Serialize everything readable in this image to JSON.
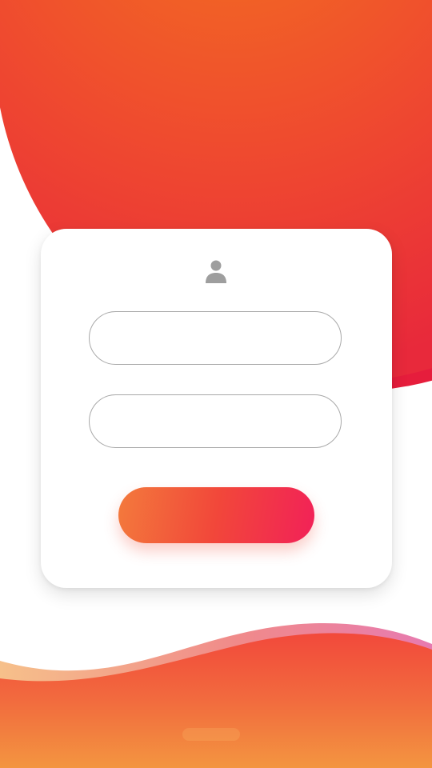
{
  "theme": {
    "gradient_orange": "#f37a3c",
    "gradient_red": "#f2473a",
    "gradient_pink": "#f22158",
    "card_background": "#ffffff",
    "field_border": "#a9a9a9",
    "icon_color": "#9e9e9e"
  },
  "login_card": {
    "avatar_icon": "user-icon",
    "username_field": {
      "value": "",
      "placeholder": ""
    },
    "password_field": {
      "value": "",
      "placeholder": ""
    },
    "login_button": {
      "label": ""
    }
  }
}
